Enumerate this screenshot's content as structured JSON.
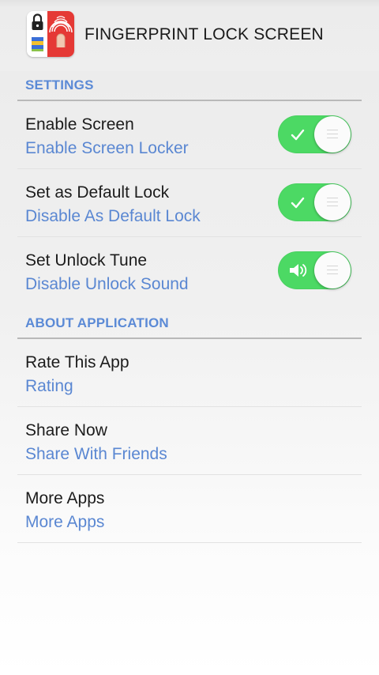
{
  "app": {
    "title": "FINGERPRINT LOCK SCREEN",
    "icon": "fingerprint-lock-app-icon"
  },
  "sections": {
    "settings": {
      "header": "SETTINGS",
      "items": [
        {
          "title": "Enable Screen",
          "subtitle": "Enable Screen Locker",
          "toggle_on": true,
          "toggle_icon": "check-icon"
        },
        {
          "title": "Set as Default Lock",
          "subtitle": "Disable As Default Lock",
          "toggle_on": true,
          "toggle_icon": "check-icon"
        },
        {
          "title": "Set Unlock Tune",
          "subtitle": "Disable Unlock Sound",
          "toggle_on": true,
          "toggle_icon": "speaker-icon"
        }
      ]
    },
    "about": {
      "header": "ABOUT APPLICATION",
      "items": [
        {
          "title": "Rate This App",
          "subtitle": "Rating"
        },
        {
          "title": "Share Now",
          "subtitle": "Share With Friends"
        },
        {
          "title": "More Apps",
          "subtitle": "More Apps"
        }
      ]
    }
  },
  "colors": {
    "accent_text": "#5a87d2",
    "toggle_on": "#4cd964",
    "icon_red": "#e53935"
  }
}
